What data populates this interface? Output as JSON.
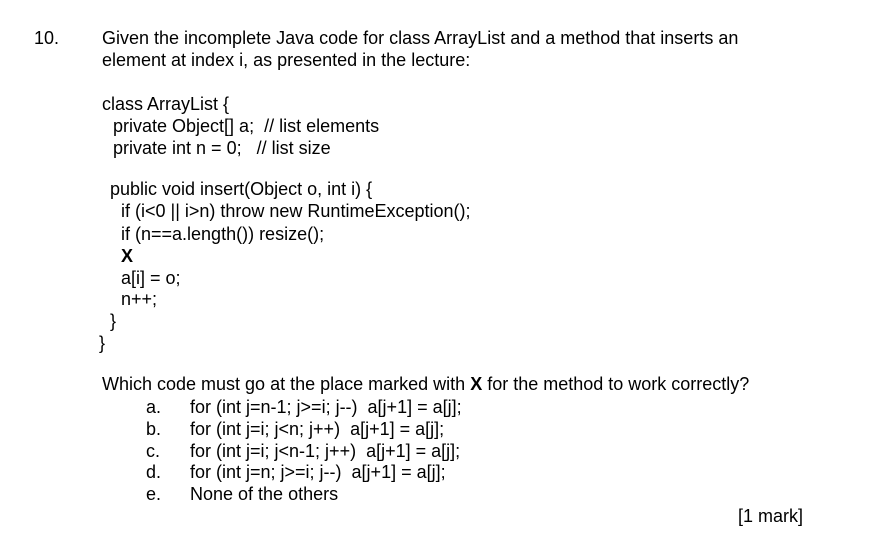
{
  "question": {
    "number": "10.",
    "prompt_line1": "Given the incomplete Java code for class ArrayList and a method that inserts an",
    "prompt_line2": "element at index i, as presented in the lecture:"
  },
  "code": {
    "lines": [
      "class ArrayList {",
      "private Object[] a;  // list elements",
      "private int n = 0;   // list size",
      "public void insert(Object o, int i) {",
      "if (i<0 || i>n) throw new RuntimeException();",
      "if (n==a.length()) resize();",
      "X",
      "a[i] = o;",
      "n++;",
      "}",
      "}"
    ]
  },
  "followup": {
    "before_marker": "Which code must go at the place marked with ",
    "marker": "X",
    "after_marker": " for the method to work correctly?"
  },
  "options": [
    {
      "letter": "a.",
      "text": "for (int j=n-1; j>=i; j--)  a[j+1] = a[j];"
    },
    {
      "letter": "b.",
      "text": "for (int j=i; j<n; j++)  a[j+1] = a[j];"
    },
    {
      "letter": "c.",
      "text": "for (int j=i; j<n-1; j++)  a[j+1] = a[j];"
    },
    {
      "letter": "d.",
      "text": "for (int j=n; j>=i; j--)  a[j+1] = a[j];"
    },
    {
      "letter": "e.",
      "text": "None of the others"
    }
  ],
  "marks": "[1 mark]"
}
